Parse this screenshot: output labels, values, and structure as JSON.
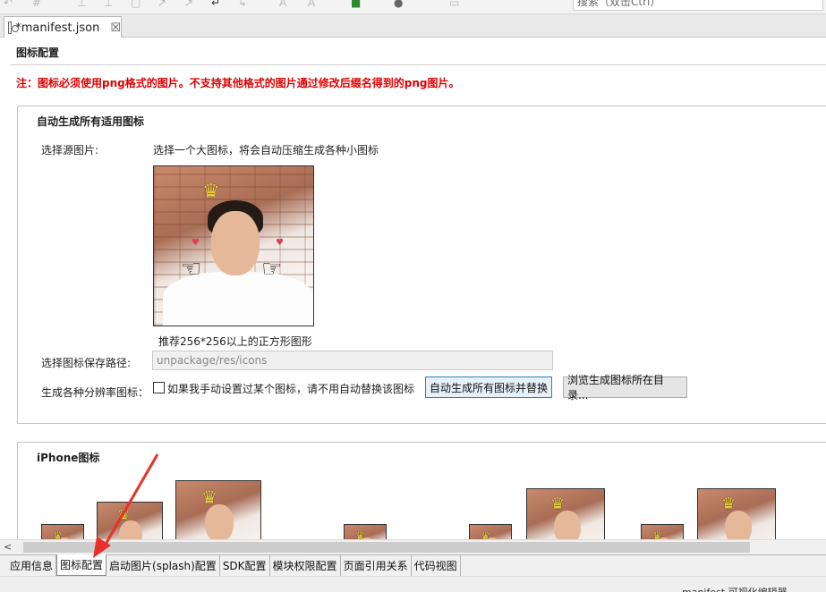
{
  "toolbar": {
    "search_placeholder": "搜索（双击Ctrl）"
  },
  "editor_tab": {
    "title": "*manifest.json",
    "close_glyph": "☒"
  },
  "page": {
    "section_title": "图标配置",
    "warning": "注：图标必须使用png格式的图片。不支持其他格式的图片通过修改后缀名得到的png图片。"
  },
  "auto_group": {
    "title": "自动生成所有适用图标",
    "source_label": "选择源图片:",
    "source_hint": "选择一个大图标，将会自动压缩生成各种小图标",
    "image_caption": "推荐256*256以上的正方形图形",
    "save_path_label": "选择图标保存路径:",
    "save_path_value": "unpackage/res/icons",
    "resolution_label": "生成各种分辨率图标：",
    "checkbox_label": "如果我手动设置过某个图标，请不用自动替换该图标",
    "generate_button": "自动生成所有图标并替换",
    "browse_button": "浏览生成图标所在目录..."
  },
  "iphone_group": {
    "title": "iPhone图标"
  },
  "bottom_tabs": [
    {
      "label": "应用信息"
    },
    {
      "label": "图标配置"
    },
    {
      "label": "启动图片(splash)配置"
    },
    {
      "label": "SDK配置"
    },
    {
      "label": "模块权限配置"
    },
    {
      "label": "页面引用关系"
    },
    {
      "label": "代码视图"
    }
  ],
  "status_bar": {
    "text": "manifest 可视化编辑器"
  },
  "colors": {
    "warning": "#e00000",
    "annotation_arrow": "#e8312a",
    "primary_button_border": "#3c7fb1"
  }
}
